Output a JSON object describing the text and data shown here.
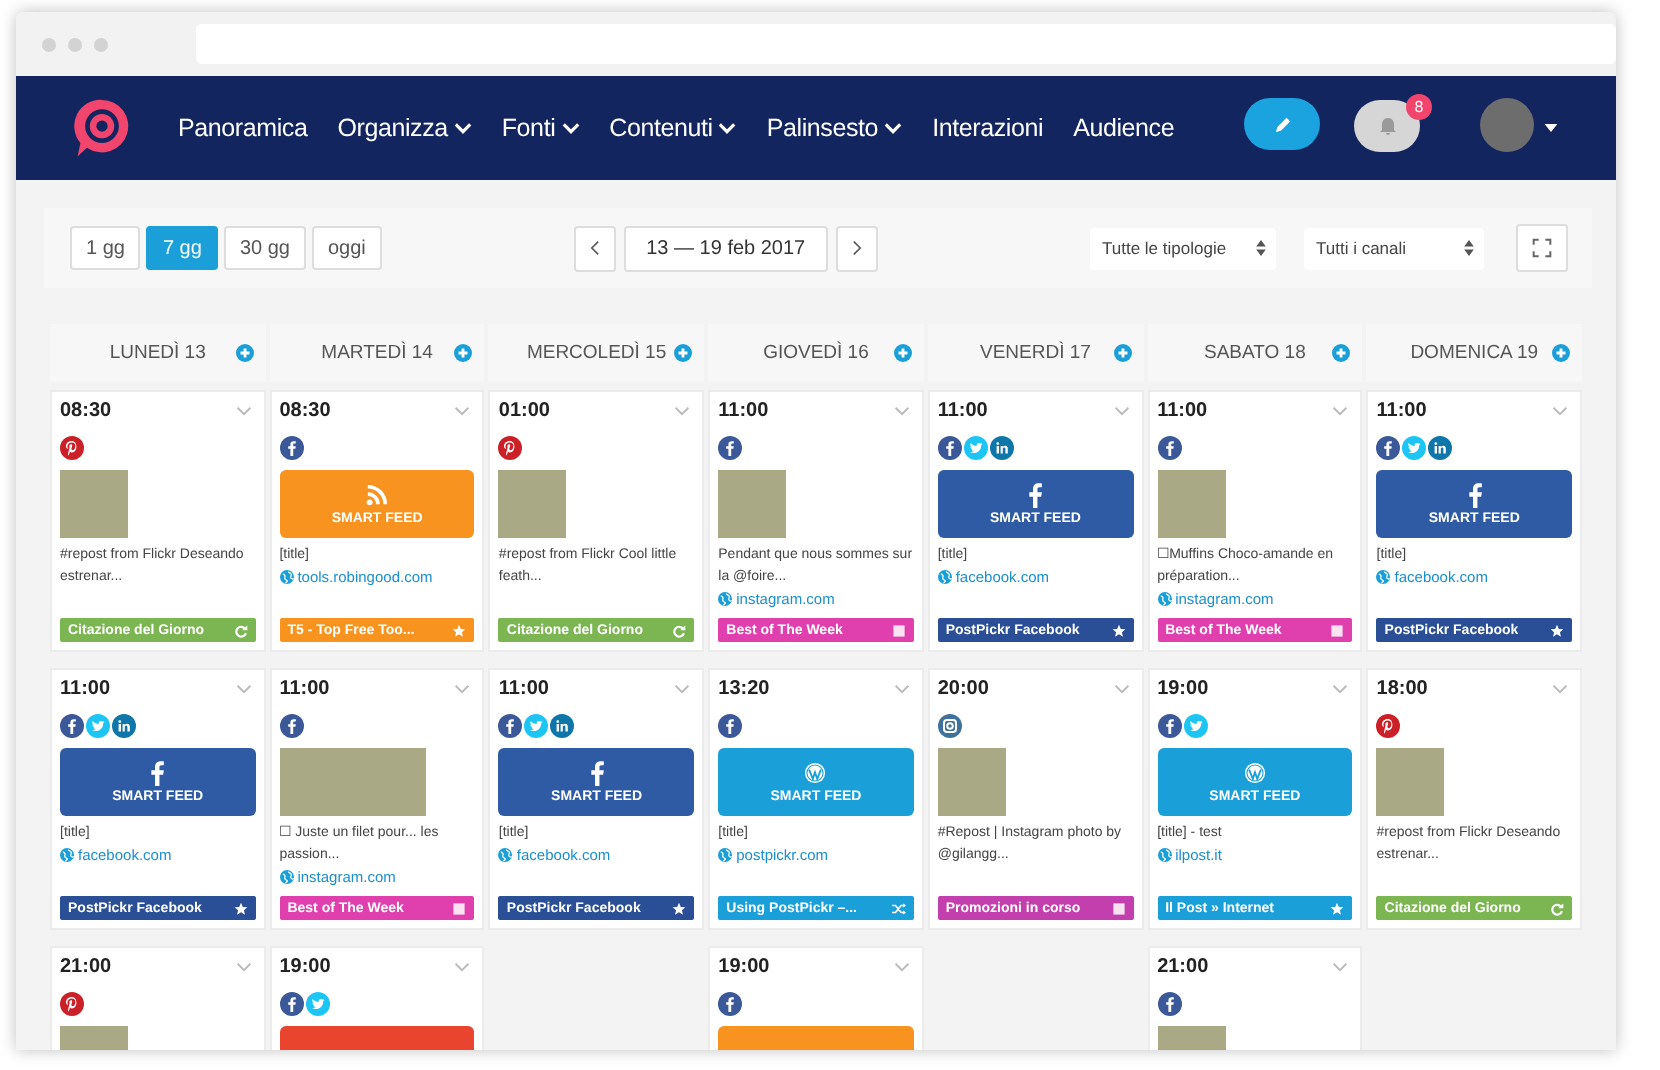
{
  "nav": {
    "items": [
      {
        "label": "Panoramica",
        "dropdown": false
      },
      {
        "label": "Organizza",
        "dropdown": true
      },
      {
        "label": "Fonti",
        "dropdown": true
      },
      {
        "label": "Contenuti",
        "dropdown": true
      },
      {
        "label": "Palinsesto",
        "dropdown": true
      },
      {
        "label": "Interazioni",
        "dropdown": false
      },
      {
        "label": "Audience",
        "dropdown": false
      }
    ],
    "notification_count": "8"
  },
  "toolbar": {
    "ranges": [
      {
        "label": "1 gg",
        "selected": false
      },
      {
        "label": "7 gg",
        "selected": true
      },
      {
        "label": "30 gg",
        "selected": false
      },
      {
        "label": "oggi",
        "selected": false
      }
    ],
    "date_range": "13 — 19 feb 2017",
    "type_filter": "Tutte le tipologie",
    "channel_filter": "Tutti i canali"
  },
  "days": [
    {
      "label": "LUNEDÌ 13",
      "cards": [
        {
          "time": "08:30",
          "socials": [
            {
              "kind": "pinterest"
            }
          ],
          "media": {
            "kind": "image"
          },
          "text": "#repost from Flickr Deseando estrenar...",
          "tag": {
            "label": "Citazione del Giorno",
            "color": "#7cb653",
            "kind": "refresh"
          }
        },
        {
          "time": "11:00",
          "socials": [
            {
              "kind": "facebook"
            },
            {
              "kind": "twitter"
            },
            {
              "kind": "linkedin"
            }
          ],
          "media": {
            "kind": "facebook_feed",
            "color": "#2e5ba3",
            "label": "SMART FEED"
          },
          "text": "[title]",
          "link": "facebook.com",
          "tag": {
            "label": "PostPickr Facebook",
            "color": "#2b4f96",
            "kind": "star"
          }
        },
        {
          "time": "21:00",
          "socials": [
            {
              "kind": "pinterest"
            }
          ],
          "media": {
            "kind": "image"
          }
        }
      ]
    },
    {
      "label": "MARTEDÌ 14",
      "cards": [
        {
          "time": "08:30",
          "socials": [
            {
              "kind": "facebook"
            }
          ],
          "media": {
            "kind": "rss_feed",
            "color": "#f7931e",
            "label": "SMART FEED"
          },
          "text": "[title]",
          "link": "tools.robingood.com",
          "tag": {
            "label": "T5 - Top Free Too...",
            "color": "#f7931e",
            "kind": "star"
          }
        },
        {
          "time": "11:00",
          "socials": [
            {
              "kind": "facebook"
            }
          ],
          "media": {
            "kind": "wide_image"
          },
          "text": "☐ Juste un filet pour... les passion...",
          "link": "instagram.com",
          "tag": {
            "label": "Best of The Week",
            "color": "#e03fae",
            "kind": "square"
          }
        },
        {
          "time": "19:00",
          "socials": [
            {
              "kind": "facebook"
            },
            {
              "kind": "twitter"
            }
          ],
          "media": {
            "kind": "plain_feed",
            "color": "#e8442e"
          }
        }
      ]
    },
    {
      "label": "MERCOLEDÌ 15",
      "cards": [
        {
          "time": "01:00",
          "socials": [
            {
              "kind": "pinterest"
            }
          ],
          "media": {
            "kind": "image"
          },
          "text": "#repost from Flickr Cool little feath...",
          "tag": {
            "label": "Citazione del Giorno",
            "color": "#7cb653",
            "kind": "refresh"
          }
        },
        {
          "time": "11:00",
          "socials": [
            {
              "kind": "facebook"
            },
            {
              "kind": "twitter"
            },
            {
              "kind": "linkedin"
            }
          ],
          "media": {
            "kind": "facebook_feed",
            "color": "#2e5ba3",
            "label": "SMART FEED"
          },
          "text": "[title]",
          "link": "facebook.com",
          "tag": {
            "label": "PostPickr Facebook",
            "color": "#2b4f96",
            "kind": "star"
          }
        }
      ]
    },
    {
      "label": "GIOVEDÌ 16",
      "cards": [
        {
          "time": "11:00",
          "socials": [
            {
              "kind": "facebook"
            }
          ],
          "media": {
            "kind": "image"
          },
          "text": "Pendant que nous sommes sur la @foire...",
          "link": "instagram.com",
          "tag": {
            "label": "Best of The Week",
            "color": "#e03fae",
            "kind": "square"
          }
        },
        {
          "time": "13:20",
          "socials": [
            {
              "kind": "facebook"
            }
          ],
          "media": {
            "kind": "wordpress_feed",
            "color": "#1a9fd9",
            "label": "SMART FEED"
          },
          "text": "[title]",
          "link": "postpickr.com",
          "tag": {
            "label": "Using PostPickr –...",
            "color": "#1a9fd9",
            "kind": "shuffle"
          }
        },
        {
          "time": "19:00",
          "socials": [
            {
              "kind": "facebook"
            }
          ],
          "media": {
            "kind": "plain_feed",
            "color": "#f7931e"
          }
        }
      ]
    },
    {
      "label": "VENERDÌ 17",
      "cards": [
        {
          "time": "11:00",
          "socials": [
            {
              "kind": "facebook"
            },
            {
              "kind": "twitter"
            },
            {
              "kind": "linkedin"
            }
          ],
          "media": {
            "kind": "facebook_feed",
            "color": "#2e5ba3",
            "label": "SMART FEED"
          },
          "text": "[title]",
          "link": "facebook.com",
          "tag": {
            "label": "PostPickr Facebook",
            "color": "#2b4f96",
            "kind": "star"
          }
        },
        {
          "time": "20:00",
          "socials": [
            {
              "kind": "instagram"
            }
          ],
          "media": {
            "kind": "image"
          },
          "text": "#Repost | Instagram photo by @gilangg...",
          "tag": {
            "label": "Promozioni in corso",
            "color": "#c43fae",
            "kind": "square"
          }
        }
      ]
    },
    {
      "label": "SABATO 18",
      "cards": [
        {
          "time": "11:00",
          "socials": [
            {
              "kind": "facebook"
            }
          ],
          "media": {
            "kind": "image"
          },
          "text": "☐Muffins Choco-amande en préparation...",
          "link": "instagram.com",
          "tag": {
            "label": "Best of The Week",
            "color": "#e03fae",
            "kind": "square"
          }
        },
        {
          "time": "19:00",
          "socials": [
            {
              "kind": "facebook"
            },
            {
              "kind": "twitter"
            }
          ],
          "media": {
            "kind": "wordpress_feed",
            "color": "#1a9fd9",
            "label": "SMART FEED"
          },
          "text": "[title] - test",
          "link": "ilpost.it",
          "tag": {
            "label": "Il Post » Internet",
            "color": "#1a9fd9",
            "kind": "star"
          }
        },
        {
          "time": "21:00",
          "socials": [
            {
              "kind": "facebook"
            }
          ],
          "media": {
            "kind": "image"
          }
        }
      ]
    },
    {
      "label": "DOMENICA 19",
      "cards": [
        {
          "time": "11:00",
          "socials": [
            {
              "kind": "facebook"
            },
            {
              "kind": "twitter"
            },
            {
              "kind": "linkedin"
            }
          ],
          "media": {
            "kind": "facebook_feed",
            "color": "#2e5ba3",
            "label": "SMART FEED"
          },
          "text": "[title]",
          "link": "facebook.com",
          "tag": {
            "label": "PostPickr Facebook",
            "color": "#2b4f96",
            "kind": "star"
          }
        },
        {
          "time": "18:00",
          "socials": [
            {
              "kind": "pinterest"
            }
          ],
          "media": {
            "kind": "image"
          },
          "text": "#repost from Flickr Deseando estrenar...",
          "tag": {
            "label": "Citazione del Giorno",
            "color": "#7cb653",
            "kind": "refresh"
          }
        }
      ]
    }
  ]
}
